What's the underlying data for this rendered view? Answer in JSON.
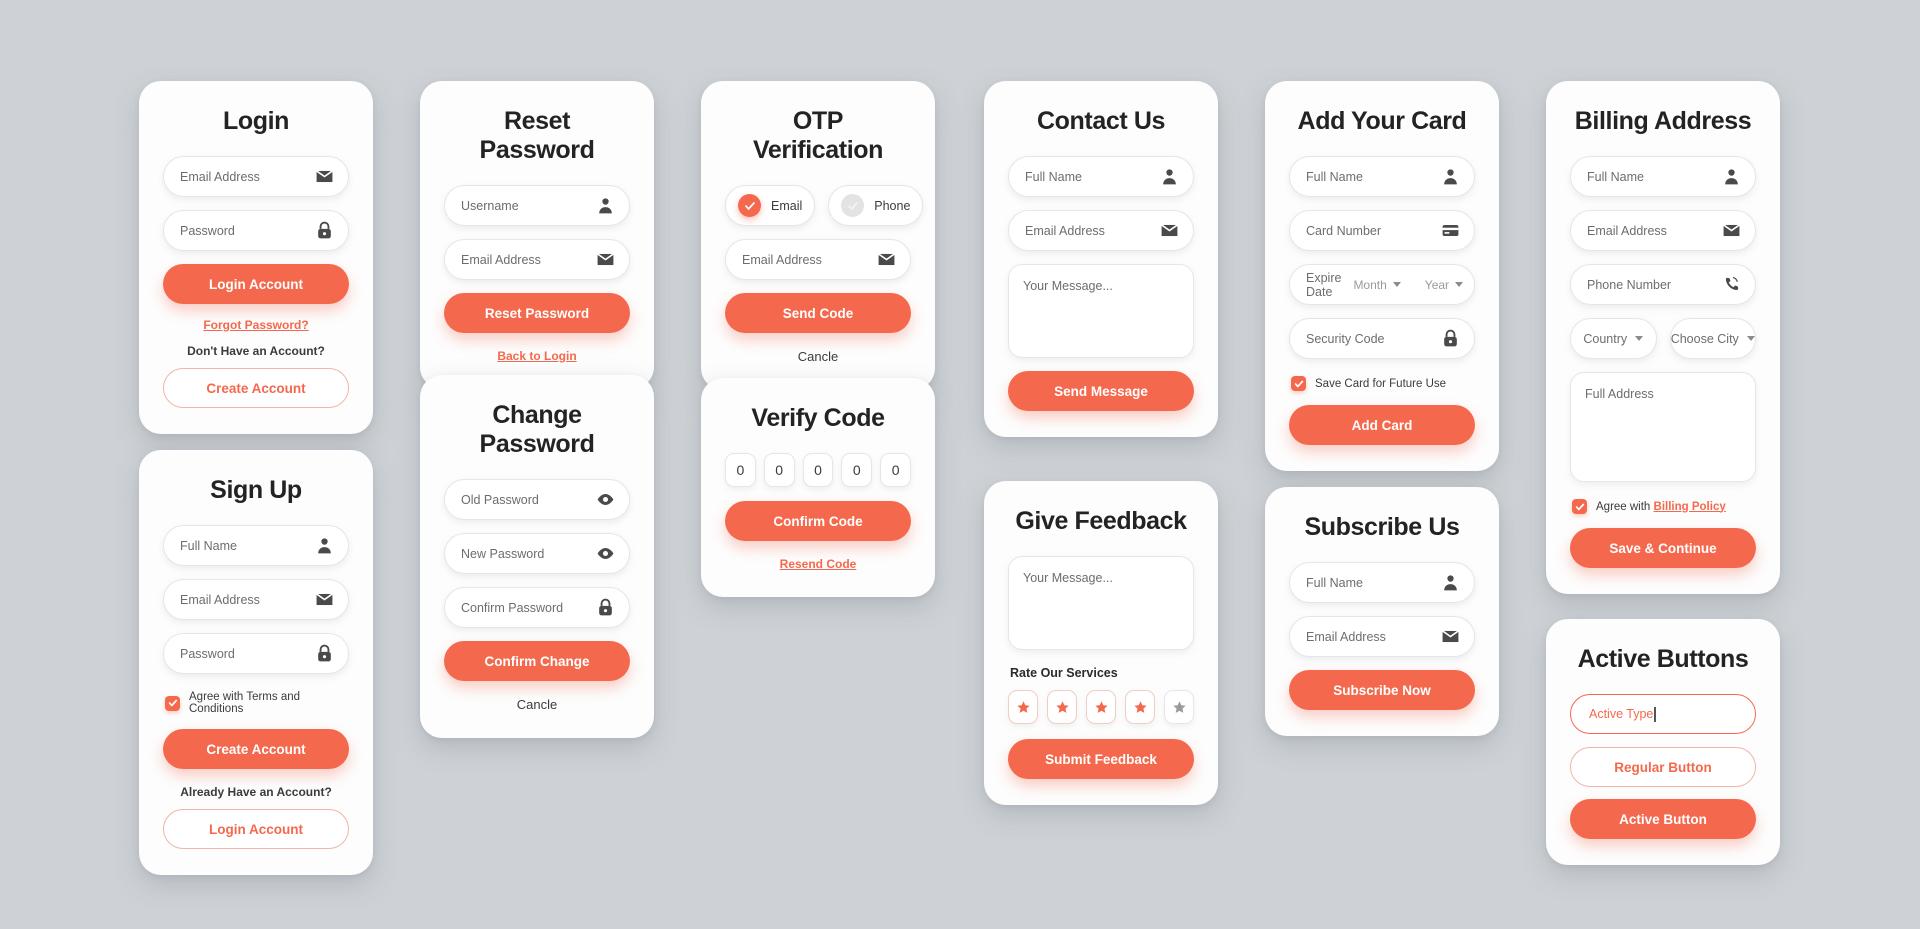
{
  "theme": {
    "accent": "#F4694D",
    "background": "#CED2D6",
    "card": "#FDFDFD",
    "text": "#232323",
    "muted": "#6D6D6D"
  },
  "login": {
    "title": "Login",
    "email_placeholder": "Email Address",
    "password_placeholder": "Password",
    "submit_label": "Login Account",
    "forgot_label": "Forgot Password?",
    "no_account_label": "Don't Have an Account?",
    "create_label": "Create Account"
  },
  "signup": {
    "title": "Sign Up",
    "fullname_placeholder": "Full Name",
    "email_placeholder": "Email Address",
    "password_placeholder": "Password",
    "agree_label": "Agree with Terms and Conditions",
    "submit_label": "Create Account",
    "have_account_label": "Already Have an Account?",
    "login_label": "Login Account"
  },
  "reset_password": {
    "title": "Reset Password",
    "username_placeholder": "Username",
    "email_placeholder": "Email Address",
    "submit_label": "Reset Password",
    "back_label": "Back to Login"
  },
  "change_password": {
    "title": "Change Password",
    "old_placeholder": "Old Password",
    "new_placeholder": "New Password",
    "confirm_placeholder": "Confirm Password",
    "submit_label": "Confirm Change",
    "cancel_label": "Cancle"
  },
  "otp": {
    "title": "OTP Verification",
    "option_email": "Email",
    "option_phone": "Phone",
    "selected_option": "Email",
    "email_placeholder": "Email Address",
    "submit_label": "Send Code",
    "cancel_label": "Cancle"
  },
  "verify_code": {
    "title": "Verify Code",
    "digits": [
      "0",
      "0",
      "0",
      "0",
      "0"
    ],
    "submit_label": "Confirm Code",
    "resend_label": "Resend Code"
  },
  "contact": {
    "title": "Contact Us",
    "fullname_placeholder": "Full Name",
    "email_placeholder": "Email Address",
    "message_placeholder": "Your Message...",
    "submit_label": "Send Message"
  },
  "feedback": {
    "title": "Give Feedback",
    "message_placeholder": "Your Message...",
    "rate_label": "Rate Our Services",
    "stars_total": 5,
    "stars_filled": 4,
    "submit_label": "Submit Feedback"
  },
  "add_card": {
    "title": "Add Your Card",
    "fullname_placeholder": "Full Name",
    "cardnumber_placeholder": "Card Number",
    "expire_label": "Expire Date",
    "month_label": "Month",
    "year_label": "Year",
    "security_placeholder": "Security Code",
    "save_card_label": "Save Card for Future Use",
    "submit_label": "Add Card"
  },
  "subscribe": {
    "title": "Subscribe Us",
    "fullname_placeholder": "Full Name",
    "email_placeholder": "Email Address",
    "submit_label": "Subscribe Now"
  },
  "billing": {
    "title": "Billing Address",
    "fullname_placeholder": "Full Name",
    "email_placeholder": "Email Address",
    "phone_placeholder": "Phone Number",
    "country_label": "Country",
    "city_label": "Choose City",
    "address_placeholder": "Full Address",
    "agree_prefix": "Agree with ",
    "agree_link": "Billing Policy",
    "submit_label": "Save & Continue"
  },
  "active_buttons": {
    "title": "Active Buttons",
    "active_type_value": "Active Type",
    "regular_label": "Regular Button",
    "active_label": "Active Button"
  }
}
